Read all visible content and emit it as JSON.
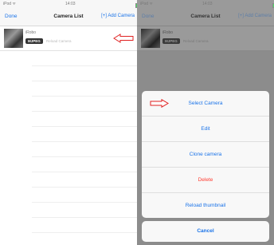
{
  "left_screen": {
    "status": {
      "carrier": "iPod ᯤ",
      "time": "14:03",
      "battery": "▮"
    },
    "nav": {
      "left": "Done",
      "title": "Camera List",
      "right": "[+] Add Camera"
    },
    "camera": {
      "name": "iRobo",
      "badge": "MJPEG",
      "subtitle": "Reload Camera"
    }
  },
  "right_screen": {
    "status": {
      "carrier": "iPod ᯤ",
      "time": "14:03",
      "battery": "▮"
    },
    "nav": {
      "left": "Done",
      "title": "Camera List",
      "right": "[+] Add Camera"
    },
    "camera": {
      "name": "iRobo",
      "badge": "MJPEG",
      "subtitle": "Reload Camera"
    },
    "action_sheet": {
      "items": [
        {
          "label": "Select Camera"
        },
        {
          "label": "Edit"
        },
        {
          "label": "Clone camera"
        },
        {
          "label": "Delete"
        },
        {
          "label": "Reload thumbnail"
        }
      ],
      "cancel": "Cancel"
    }
  },
  "colors": {
    "accent": "#1a73e8",
    "destructive": "#ff3b30",
    "annotation_arrow": "#e02020",
    "overlay": "#8c8c8c"
  },
  "icons": {
    "pointer_arrow": "left-arrow-icon",
    "pointer_arrow_right": "right-arrow-icon"
  }
}
